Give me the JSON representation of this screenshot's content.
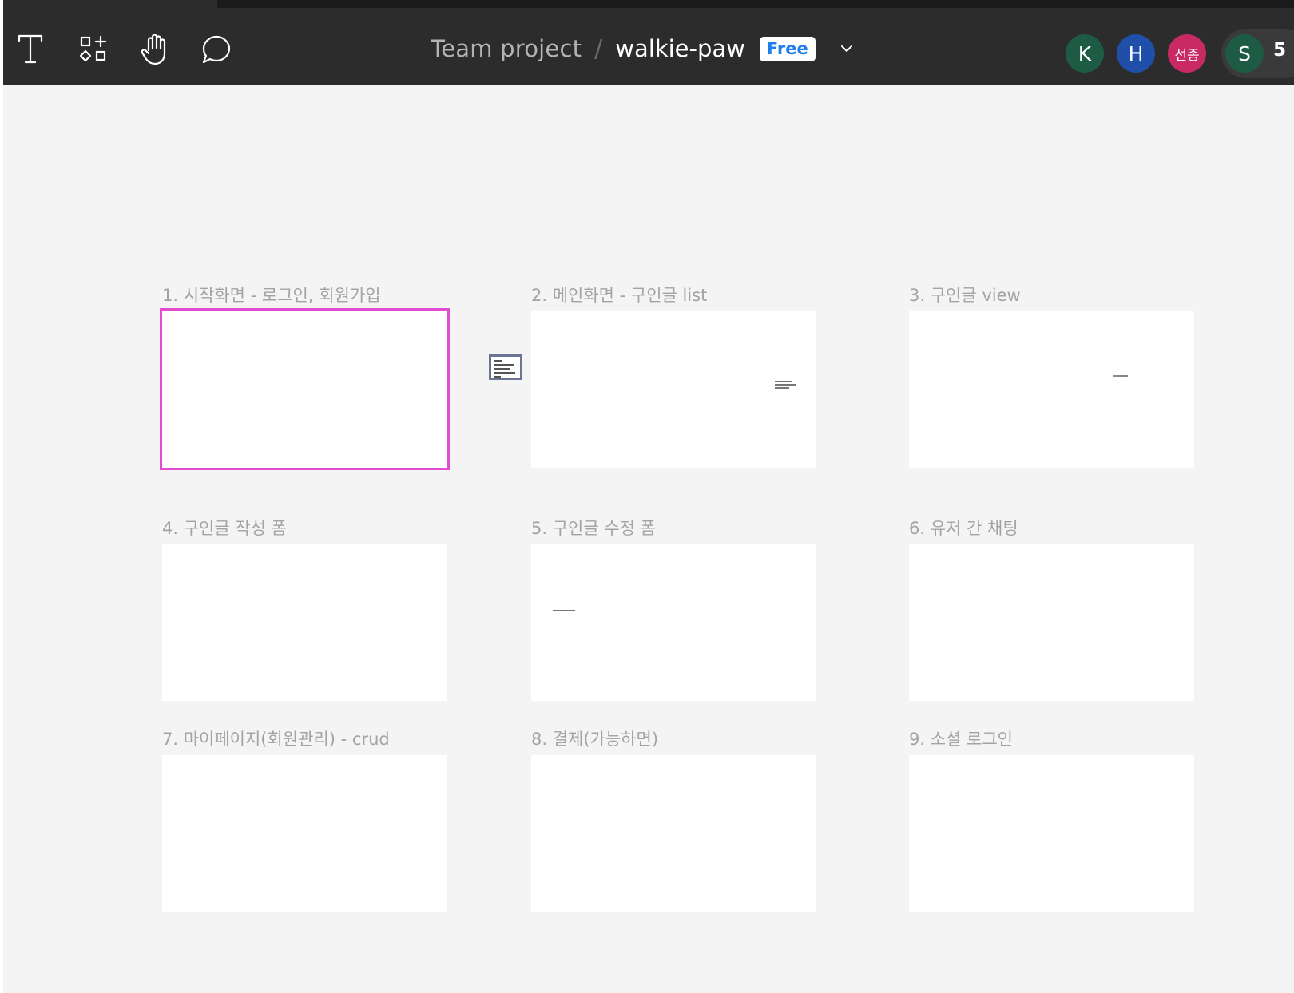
{
  "toolbar": {
    "tools": [
      {
        "name": "text-tool",
        "icon": "text-icon"
      },
      {
        "name": "components-tool",
        "icon": "components-icon"
      },
      {
        "name": "hand-tool",
        "icon": "hand-icon"
      },
      {
        "name": "comment-tool",
        "icon": "comment-icon"
      }
    ],
    "breadcrumb": {
      "team": "Team project",
      "separator": "/",
      "file": "walkie-paw",
      "plan_badge": "Free"
    },
    "collaborators": [
      {
        "initial": "K",
        "color": "#1e5b45"
      },
      {
        "initial": "H",
        "color": "#1f4fa8"
      },
      {
        "initial": "선종",
        "color": "#c92a64"
      }
    ],
    "current_user": {
      "initial": "S",
      "color": "#1e5b45"
    },
    "collaborator_count": "5"
  },
  "canvas": {
    "frames": [
      {
        "label": "1. 시작화면 - 로그인, 회원가입",
        "selected": true
      },
      {
        "label": "2. 메인화면 - 구인글 list"
      },
      {
        "label": "3. 구인글 view"
      },
      {
        "label": "4. 구인글 작성 폼"
      },
      {
        "label": "5. 구인글 수정 폼"
      },
      {
        "label": "6. 유저 간 채팅"
      },
      {
        "label": "7. 마이페이지(회원관리) - crud"
      },
      {
        "label": "8. 결제(가능하면)"
      },
      {
        "label": "9. 소셜 로그인"
      }
    ],
    "colors": {
      "selection": "#e34bd1",
      "canvas_bg": "#f4f4f4",
      "toolbar_bg": "#2c2c2c",
      "badge_text": "#1f7ff0"
    }
  }
}
